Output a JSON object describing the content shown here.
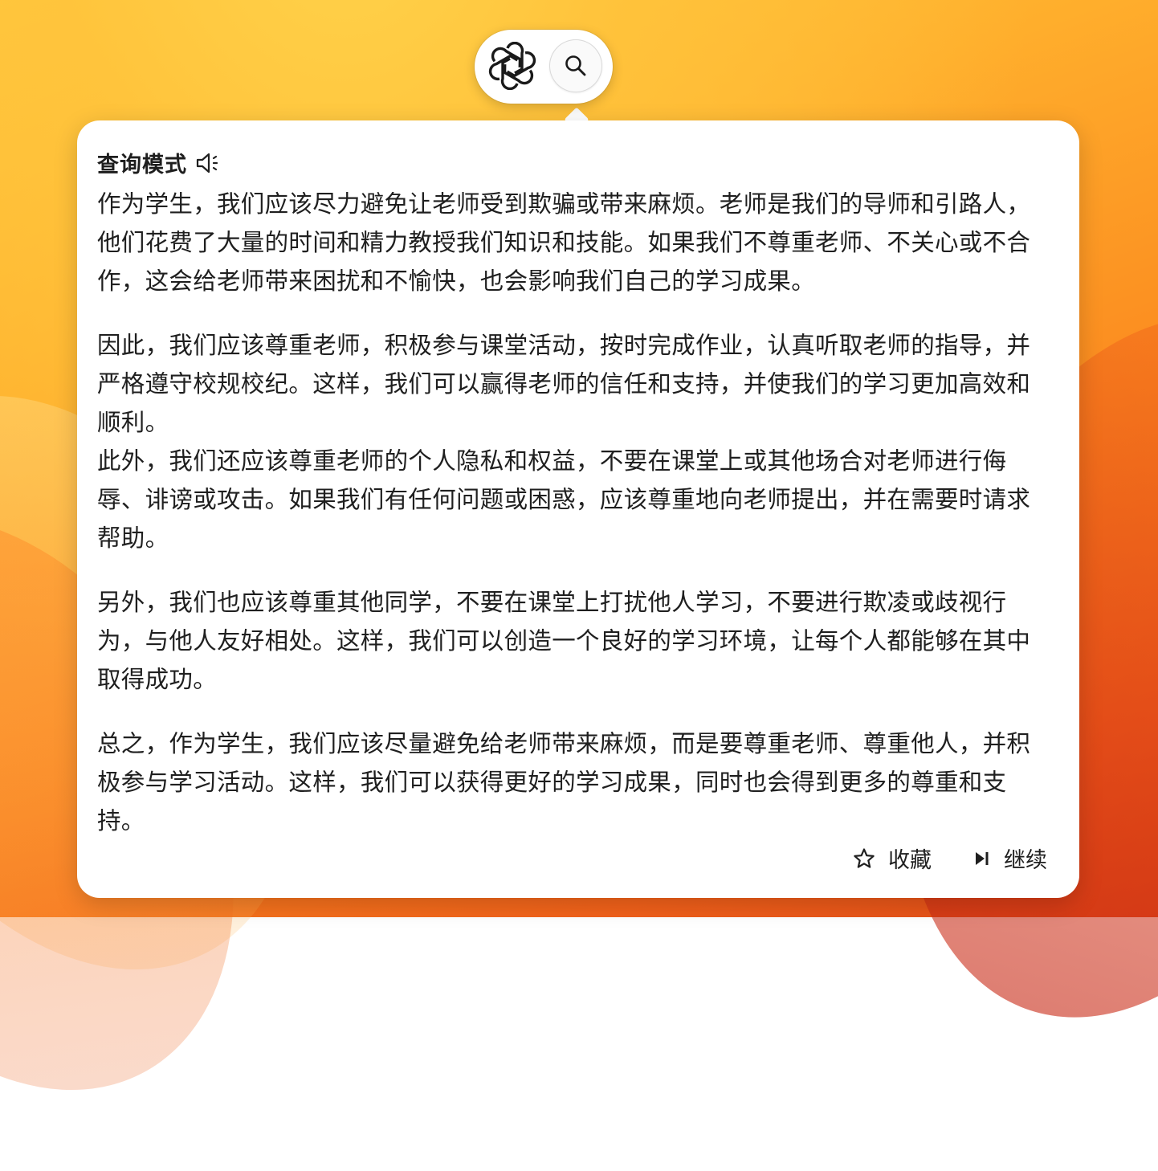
{
  "toolbar": {
    "logo_icon": "openai-logo-icon",
    "search_icon": "search-icon"
  },
  "panel": {
    "mode_label": "查询模式",
    "speaker_icon": "speaker-icon",
    "paragraphs": [
      "作为学生，我们应该尽力避免让老师受到欺骗或带来麻烦。老师是我们的导师和引路人，他们花费了大量的时间和精力教授我们知识和技能。如果我们不尊重老师、不关心或不合作，这会给老师带来困扰和不愉快，也会影响我们自己的学习成果。",
      "因此，我们应该尊重老师，积极参与课堂活动，按时完成作业，认真听取老师的指导，并严格遵守校规校纪。这样，我们可以赢得老师的信任和支持，并使我们的学习更加高效和顺利。",
      "此外，我们还应该尊重老师的个人隐私和权益，不要在课堂上或其他场合对老师进行侮辱、诽谤或攻击。如果我们有任何问题或困惑，应该尊重地向老师提出，并在需要时请求帮助。",
      "另外，我们也应该尊重其他同学，不要在课堂上打扰他人学习，不要进行欺凌或歧视行为，与他人友好相处。这样，我们可以创造一个良好的学习环境，让每个人都能够在其中取得成功。",
      "总之，作为学生，我们应该尽量避免给老师带来麻烦，而是要尊重老师、尊重他人，并积极参与学习活动。这样，我们可以获得更好的学习成果，同时也会得到更多的尊重和支持。"
    ],
    "actions": {
      "favorite_label": "收藏",
      "favorite_icon": "star-icon",
      "continue_label": "继续",
      "continue_icon": "play-next-icon"
    }
  },
  "colors": {
    "wallpaper_top": "#ffc93d",
    "wallpaper_bottom": "#e04a17",
    "card_background": "#ffffff",
    "text": "#1f1f1f"
  }
}
